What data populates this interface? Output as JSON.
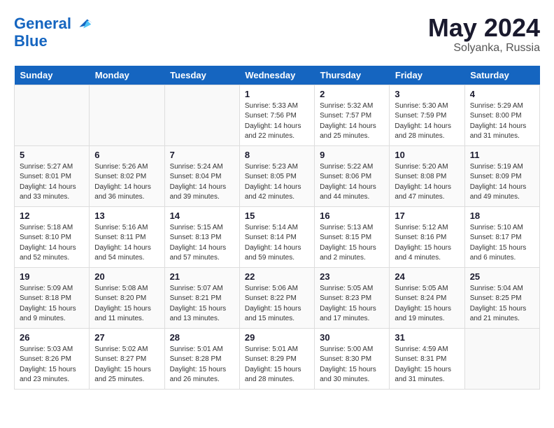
{
  "logo": {
    "line1": "General",
    "line2": "Blue"
  },
  "title": "May 2024",
  "location": "Solyanka, Russia",
  "days_header": [
    "Sunday",
    "Monday",
    "Tuesday",
    "Wednesday",
    "Thursday",
    "Friday",
    "Saturday"
  ],
  "weeks": [
    [
      {
        "num": "",
        "info": ""
      },
      {
        "num": "",
        "info": ""
      },
      {
        "num": "",
        "info": ""
      },
      {
        "num": "1",
        "info": "Sunrise: 5:33 AM\nSunset: 7:56 PM\nDaylight: 14 hours\nand 22 minutes."
      },
      {
        "num": "2",
        "info": "Sunrise: 5:32 AM\nSunset: 7:57 PM\nDaylight: 14 hours\nand 25 minutes."
      },
      {
        "num": "3",
        "info": "Sunrise: 5:30 AM\nSunset: 7:59 PM\nDaylight: 14 hours\nand 28 minutes."
      },
      {
        "num": "4",
        "info": "Sunrise: 5:29 AM\nSunset: 8:00 PM\nDaylight: 14 hours\nand 31 minutes."
      }
    ],
    [
      {
        "num": "5",
        "info": "Sunrise: 5:27 AM\nSunset: 8:01 PM\nDaylight: 14 hours\nand 33 minutes."
      },
      {
        "num": "6",
        "info": "Sunrise: 5:26 AM\nSunset: 8:02 PM\nDaylight: 14 hours\nand 36 minutes."
      },
      {
        "num": "7",
        "info": "Sunrise: 5:24 AM\nSunset: 8:04 PM\nDaylight: 14 hours\nand 39 minutes."
      },
      {
        "num": "8",
        "info": "Sunrise: 5:23 AM\nSunset: 8:05 PM\nDaylight: 14 hours\nand 42 minutes."
      },
      {
        "num": "9",
        "info": "Sunrise: 5:22 AM\nSunset: 8:06 PM\nDaylight: 14 hours\nand 44 minutes."
      },
      {
        "num": "10",
        "info": "Sunrise: 5:20 AM\nSunset: 8:08 PM\nDaylight: 14 hours\nand 47 minutes."
      },
      {
        "num": "11",
        "info": "Sunrise: 5:19 AM\nSunset: 8:09 PM\nDaylight: 14 hours\nand 49 minutes."
      }
    ],
    [
      {
        "num": "12",
        "info": "Sunrise: 5:18 AM\nSunset: 8:10 PM\nDaylight: 14 hours\nand 52 minutes."
      },
      {
        "num": "13",
        "info": "Sunrise: 5:16 AM\nSunset: 8:11 PM\nDaylight: 14 hours\nand 54 minutes."
      },
      {
        "num": "14",
        "info": "Sunrise: 5:15 AM\nSunset: 8:13 PM\nDaylight: 14 hours\nand 57 minutes."
      },
      {
        "num": "15",
        "info": "Sunrise: 5:14 AM\nSunset: 8:14 PM\nDaylight: 14 hours\nand 59 minutes."
      },
      {
        "num": "16",
        "info": "Sunrise: 5:13 AM\nSunset: 8:15 PM\nDaylight: 15 hours\nand 2 minutes."
      },
      {
        "num": "17",
        "info": "Sunrise: 5:12 AM\nSunset: 8:16 PM\nDaylight: 15 hours\nand 4 minutes."
      },
      {
        "num": "18",
        "info": "Sunrise: 5:10 AM\nSunset: 8:17 PM\nDaylight: 15 hours\nand 6 minutes."
      }
    ],
    [
      {
        "num": "19",
        "info": "Sunrise: 5:09 AM\nSunset: 8:18 PM\nDaylight: 15 hours\nand 9 minutes."
      },
      {
        "num": "20",
        "info": "Sunrise: 5:08 AM\nSunset: 8:20 PM\nDaylight: 15 hours\nand 11 minutes."
      },
      {
        "num": "21",
        "info": "Sunrise: 5:07 AM\nSunset: 8:21 PM\nDaylight: 15 hours\nand 13 minutes."
      },
      {
        "num": "22",
        "info": "Sunrise: 5:06 AM\nSunset: 8:22 PM\nDaylight: 15 hours\nand 15 minutes."
      },
      {
        "num": "23",
        "info": "Sunrise: 5:05 AM\nSunset: 8:23 PM\nDaylight: 15 hours\nand 17 minutes."
      },
      {
        "num": "24",
        "info": "Sunrise: 5:05 AM\nSunset: 8:24 PM\nDaylight: 15 hours\nand 19 minutes."
      },
      {
        "num": "25",
        "info": "Sunrise: 5:04 AM\nSunset: 8:25 PM\nDaylight: 15 hours\nand 21 minutes."
      }
    ],
    [
      {
        "num": "26",
        "info": "Sunrise: 5:03 AM\nSunset: 8:26 PM\nDaylight: 15 hours\nand 23 minutes."
      },
      {
        "num": "27",
        "info": "Sunrise: 5:02 AM\nSunset: 8:27 PM\nDaylight: 15 hours\nand 25 minutes."
      },
      {
        "num": "28",
        "info": "Sunrise: 5:01 AM\nSunset: 8:28 PM\nDaylight: 15 hours\nand 26 minutes."
      },
      {
        "num": "29",
        "info": "Sunrise: 5:01 AM\nSunset: 8:29 PM\nDaylight: 15 hours\nand 28 minutes."
      },
      {
        "num": "30",
        "info": "Sunrise: 5:00 AM\nSunset: 8:30 PM\nDaylight: 15 hours\nand 30 minutes."
      },
      {
        "num": "31",
        "info": "Sunrise: 4:59 AM\nSunset: 8:31 PM\nDaylight: 15 hours\nand 31 minutes."
      },
      {
        "num": "",
        "info": ""
      }
    ]
  ]
}
